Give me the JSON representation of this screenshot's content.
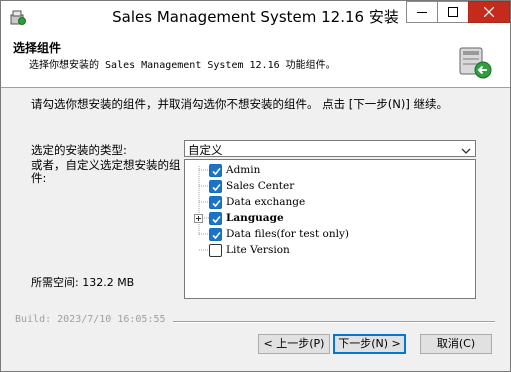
{
  "window": {
    "title": "Sales Management System 12.16 安装"
  },
  "header": {
    "title": "选择组件",
    "subtitle": "选择你想安装的 Sales Management System 12.16 功能组件。"
  },
  "instruction": "请勾选你想安装的组件，并取消勾选你不想安装的组件。 点击 [下一步(N)] 继续。",
  "install_type": {
    "label": "选定的安装的类型:",
    "selected": "自定义"
  },
  "custom_label": "或者，自定义选定想安装的组件:",
  "components": [
    {
      "label": "Admin",
      "checked": true,
      "bold": false,
      "expandable": false
    },
    {
      "label": "Sales Center",
      "checked": true,
      "bold": false,
      "expandable": false
    },
    {
      "label": "Data exchange",
      "checked": true,
      "bold": false,
      "expandable": false
    },
    {
      "label": "Language",
      "checked": true,
      "bold": true,
      "expandable": true
    },
    {
      "label": "Data files(for test only)",
      "checked": true,
      "bold": false,
      "expandable": false
    },
    {
      "label": "Lite Version",
      "checked": false,
      "bold": false,
      "expandable": false
    }
  ],
  "space_required": "所需空间: 132.2 MB",
  "build_info": "Build: 2023/7/10 16:05:55",
  "buttons": {
    "back": "< 上一步(P)",
    "next": "下一步(N) >",
    "cancel": "取消(C)"
  },
  "colors": {
    "checkbox": "#1a74c8",
    "close_button": "#c42b1c",
    "default_button_border": "#0078d7"
  },
  "icons": {
    "app": "installer-icon",
    "header": "install-component-icon"
  }
}
